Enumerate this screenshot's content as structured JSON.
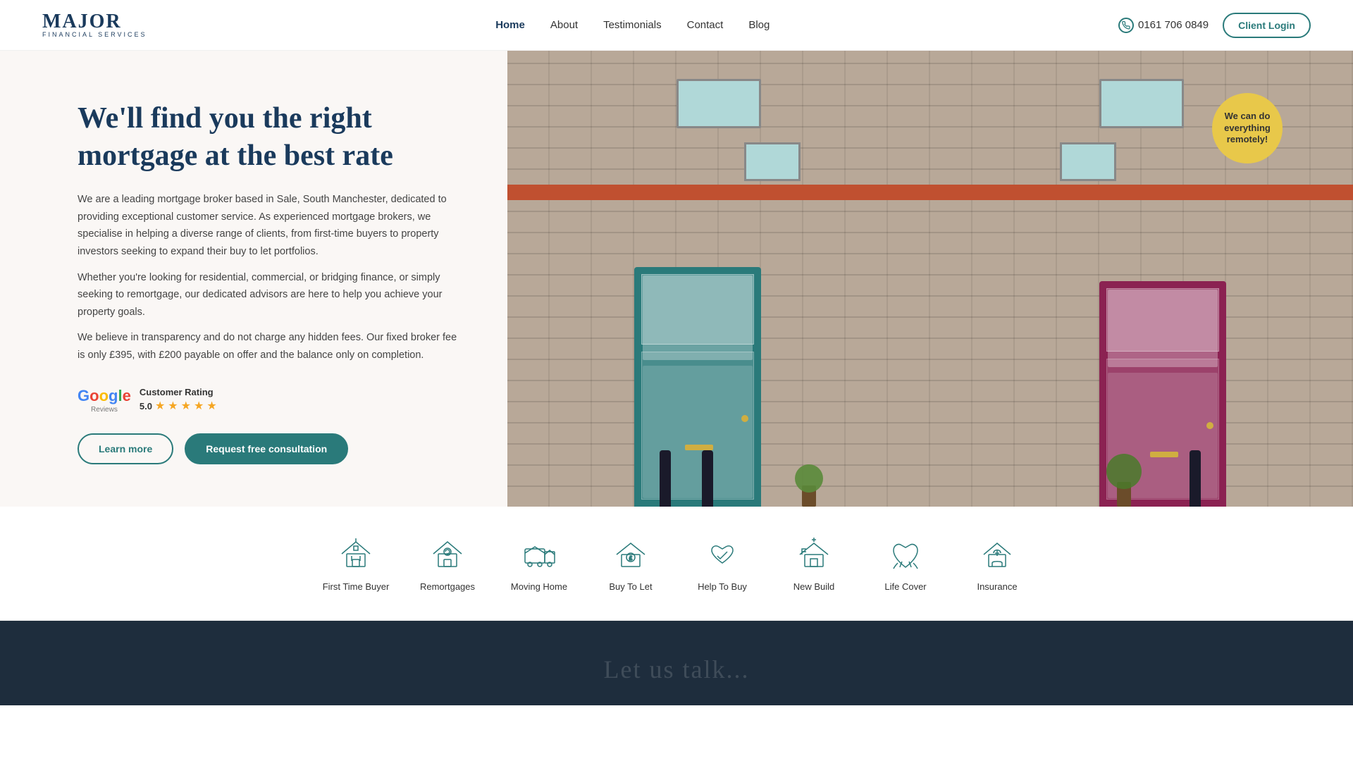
{
  "nav": {
    "logo_major": "MAJOR",
    "logo_sub": "FINANCIAL SERVICES",
    "links": [
      {
        "label": "Home",
        "active": true
      },
      {
        "label": "About",
        "active": false
      },
      {
        "label": "Testimonials",
        "active": false
      },
      {
        "label": "Contact",
        "active": false
      },
      {
        "label": "Blog",
        "active": false
      }
    ],
    "phone": "0161 706 0849",
    "client_login": "Client Login"
  },
  "hero": {
    "title": "We'll find you the right mortgage at the best rate",
    "body1": "We are a leading mortgage broker based in Sale, South Manchester, dedicated to providing exceptional customer service. As experienced mortgage brokers, we specialise in helping a diverse range of clients, from first-time buyers to property investors seeking to expand their buy to let portfolios.",
    "body2": "Whether you're looking for residential, commercial, or bridging finance, or simply seeking to remortgage, our dedicated advisors are here to help you achieve your property goals.",
    "body3": "We believe in transparency and do not charge any hidden fees. Our fixed broker fee is only £395, with £200 payable on offer and the balance only on completion.",
    "google_label": "Google",
    "reviews_label": "Reviews",
    "rating_label": "Customer Rating",
    "rating_score": "5.0",
    "stars": "★★★★★",
    "btn_learn_more": "Learn more",
    "btn_consult": "Request free consultation",
    "badge_text": "We can do everything remotely!"
  },
  "services": [
    {
      "label": "First Time Buyer",
      "icon": "house-first"
    },
    {
      "label": "Remortgages",
      "icon": "house-remortgage"
    },
    {
      "label": "Moving Home",
      "icon": "truck-home"
    },
    {
      "label": "Buy To Let",
      "icon": "house-money"
    },
    {
      "label": "Help To Buy",
      "icon": "handshake"
    },
    {
      "label": "New Build",
      "icon": "house-key"
    },
    {
      "label": "Life Cover",
      "icon": "heart-hands"
    },
    {
      "label": "Insurance",
      "icon": "house-shield"
    }
  ],
  "dark_section": {
    "title": "Let us talk..."
  }
}
